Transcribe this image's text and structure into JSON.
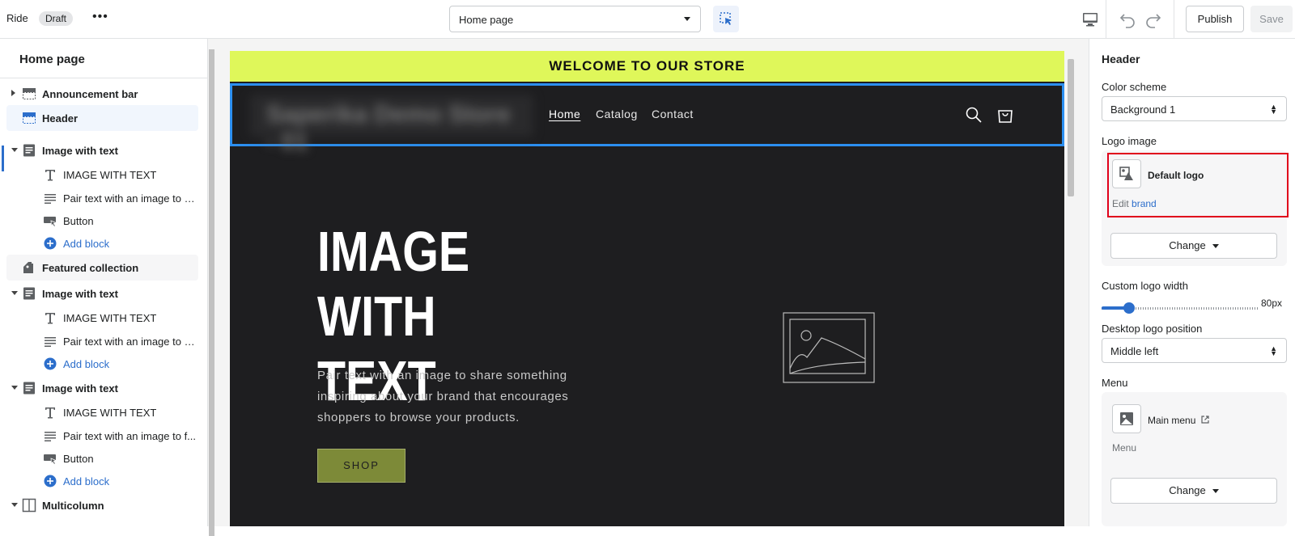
{
  "topbar": {
    "store_name": "Ride",
    "status_badge": "Draft",
    "more": "•••",
    "page_select": "Home page",
    "publish_label": "Publish",
    "save_label": "Save"
  },
  "sidebar": {
    "title": "Home page",
    "items": [
      {
        "label": "Announcement bar"
      },
      {
        "label": "Header"
      },
      {
        "label": "Image with text"
      },
      {
        "label": "IMAGE WITH TEXT"
      },
      {
        "label": "Pair text with an image to s..."
      },
      {
        "label": "Button"
      },
      {
        "label": "Add block"
      },
      {
        "label": "Featured collection"
      },
      {
        "label": "Image with text"
      },
      {
        "label": "IMAGE WITH TEXT"
      },
      {
        "label": "Pair text with an image to s..."
      },
      {
        "label": "Add block"
      },
      {
        "label": "Image with text"
      },
      {
        "label": "IMAGE WITH TEXT"
      },
      {
        "label": "Pair text with an image to f..."
      },
      {
        "label": "Button"
      },
      {
        "label": "Add block"
      },
      {
        "label": "Multicolumn"
      }
    ]
  },
  "preview": {
    "announcement": "WELCOME TO OUR STORE",
    "logo_text": "Saperika Demo Store - 01",
    "nav": [
      "Home",
      "Catalog",
      "Contact"
    ],
    "hero_title": "IMAGE WITH TEXT",
    "hero_text": "Pair text with an image to share something inspiring about your brand that encourages shoppers to browse your products.",
    "hero_button": "SHOP"
  },
  "settings": {
    "title": "Header",
    "color_scheme_label": "Color scheme",
    "color_scheme_value": "Background 1",
    "logo_image_label": "Logo image",
    "logo_name": "Default logo",
    "logo_edit_prefix": "Edit",
    "logo_edit_link": "brand",
    "change_label": "Change",
    "logo_width_label": "Custom logo width",
    "logo_width_value": "80px",
    "logo_width_fraction": 0.17,
    "logo_position_label": "Desktop logo position",
    "logo_position_value": "Middle left",
    "menu_label": "Menu",
    "menu_name": "Main menu",
    "menu_sub": "Menu"
  },
  "colors": {
    "announcement_bg": "#dff75a",
    "canvas_bg": "#1e1e20",
    "accent": "#2c6ecb",
    "button_bg": "#7d8a38",
    "highlight_border": "#e0001b"
  }
}
